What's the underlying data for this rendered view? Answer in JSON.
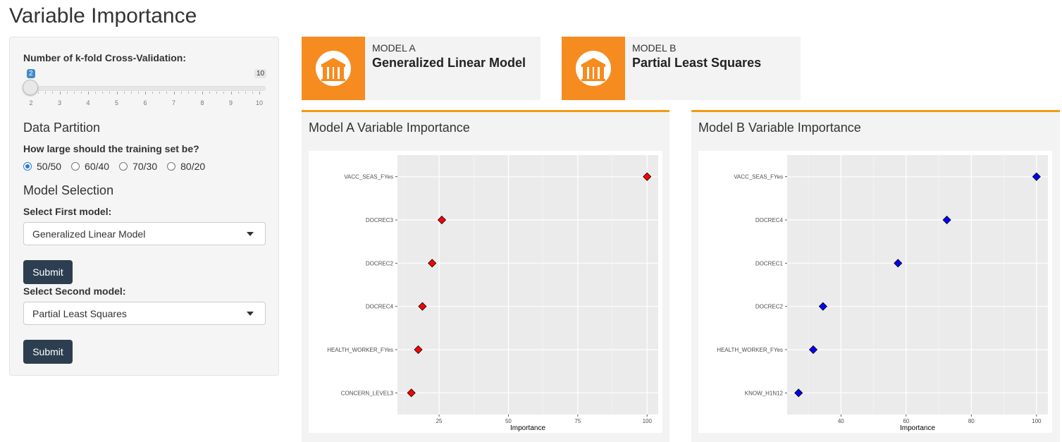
{
  "page": {
    "title": "Variable Importance"
  },
  "sidebar": {
    "kfold_label": "Number of k-fold Cross-Validation:",
    "slider": {
      "value": "2",
      "min": 2,
      "max": "10",
      "current": 2,
      "ticks": [
        "2",
        "3",
        "4",
        "5",
        "6",
        "7",
        "8",
        "9",
        "10"
      ]
    },
    "partition_heading": "Data Partition",
    "training_question": "How large should the training set be?",
    "partition_options": [
      "50/50",
      "60/40",
      "70/30",
      "80/20"
    ],
    "partition_selected": "50/50",
    "model_selection_heading": "Model Selection",
    "first_model_label": "Select First model:",
    "first_model_value": "Generalized Linear Model",
    "submit_label": "Submit",
    "second_model_label": "Select Second model:",
    "second_model_value": "Partial Least Squares",
    "submit2_label": "Submit"
  },
  "infoboxes": [
    {
      "title": "MODEL A",
      "value": "Generalized Linear Model",
      "icon": "bank-icon",
      "color": "#f68b1f"
    },
    {
      "title": "MODEL B",
      "value": "Partial Least Squares",
      "icon": "bank-icon",
      "color": "#f68b1f"
    }
  ],
  "panels": {
    "a_title": "Model A Variable Importance",
    "b_title": "Model B Variable Importance",
    "accent": "#f39c12"
  },
  "chart_data": [
    {
      "type": "scatter",
      "title": "Model A Variable Importance",
      "xlabel": "Importance",
      "ylabel": "",
      "categories": [
        "VACC_SEAS_FYes",
        "DOCREC3",
        "DOCREC2",
        "DOCREC4",
        "HEALTH_WORKER_FYes",
        "CONCERN_LEVEL3"
      ],
      "values": [
        100,
        26,
        22.5,
        19,
        17.5,
        15
      ],
      "xlim": [
        10,
        104
      ],
      "xticks": [
        "25",
        "50",
        "75",
        "100"
      ],
      "xtick_values": [
        25,
        50,
        75,
        100
      ],
      "color": "#ff0000",
      "grid": true
    },
    {
      "type": "scatter",
      "title": "Model B Variable Importance",
      "xlabel": "Importance",
      "ylabel": "",
      "categories": [
        "VACC_SEAS_FYes",
        "DOCREC4",
        "DOCREC1",
        "DOCREC2",
        "HEALTH_WORKER_FYes",
        "KNOW_H1N12"
      ],
      "values": [
        100,
        72.5,
        57.5,
        34.5,
        31.5,
        27
      ],
      "xlim": [
        23.5,
        103.5
      ],
      "xticks": [
        "40",
        "60",
        "80",
        "100"
      ],
      "xtick_values": [
        40,
        60,
        80,
        100
      ],
      "color": "#0000ff",
      "grid": true
    }
  ]
}
